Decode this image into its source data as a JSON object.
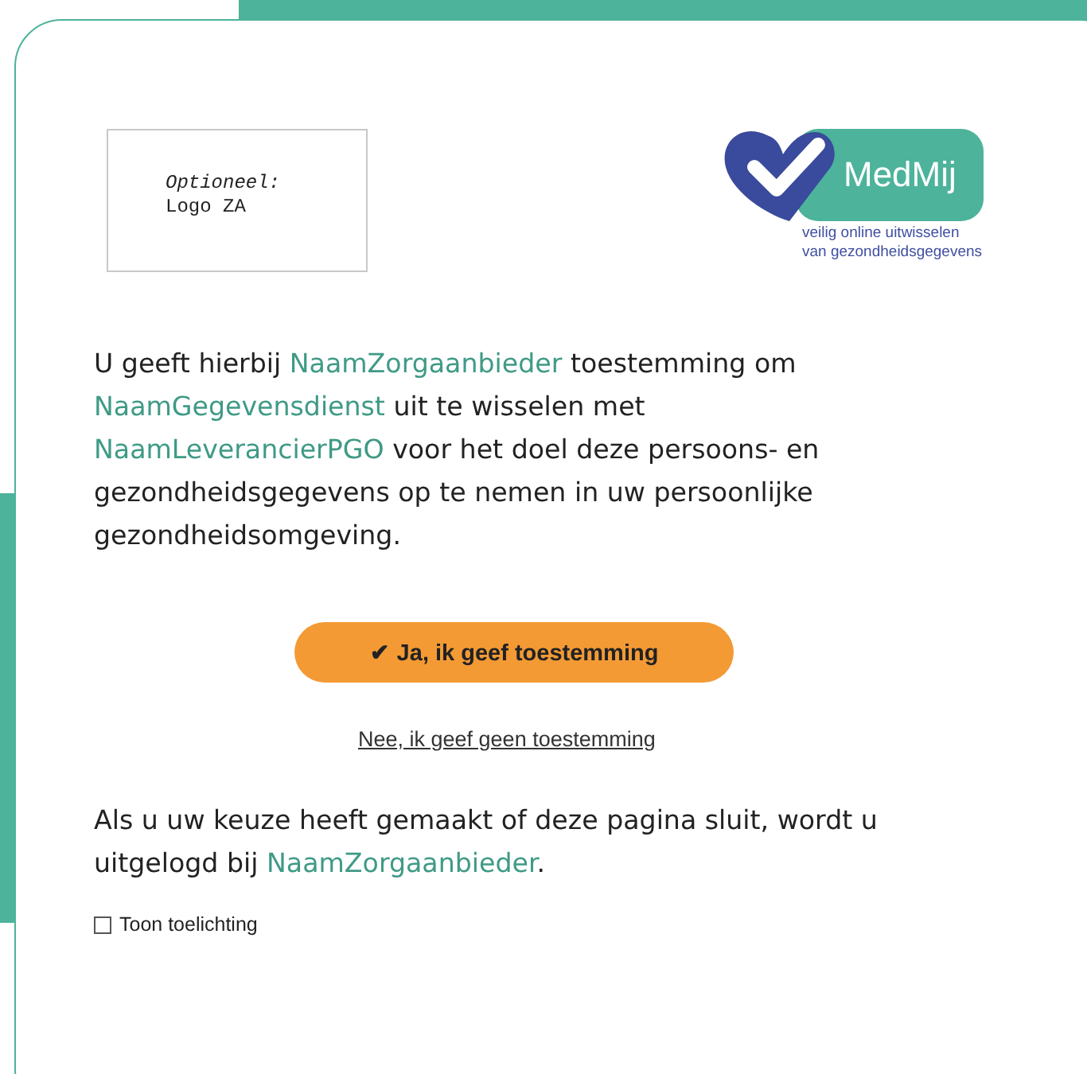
{
  "placeholder_logo": {
    "lines": [
      "Optioneel:",
      "Logo ZA"
    ]
  },
  "brand_logo": {
    "name": "MedMij",
    "tagline": [
      "veilig online uitwisselen",
      "van gezondheidsgegevens"
    ]
  },
  "consent_text": [
    {
      "text": "U geeft hierbij ",
      "highlight": false
    },
    {
      "text": "NaamZorgaanbieder",
      "highlight": true
    },
    {
      "text": " toestemming om ",
      "highlight": false
    },
    {
      "text": "NaamGegevensdienst",
      "highlight": true
    },
    {
      "text": " uit te wisselen met ",
      "highlight": false
    },
    {
      "text": "NaamLeverancierPGO",
      "highlight": true
    },
    {
      "text": " voor het doel deze persoons- en gezondheidsgegevens op te nemen in uw persoonlijke gezondheidsomgeving.",
      "highlight": false
    }
  ],
  "accept_button": {
    "icon": "✔",
    "label": "Ja, ik geef toestemming"
  },
  "decline_link": "Nee, ik geef geen toestemming",
  "logout_text": [
    {
      "text": "Als u uw keuze heeft gemaakt of deze pagina sluit, wordt u uitgelogd bij ",
      "highlight": false
    },
    {
      "text": "NaamZorgaanbieder",
      "highlight": true
    },
    {
      "text": ".",
      "highlight": false
    }
  ],
  "explain_checkbox": {
    "label": "Toon toelichting",
    "checked": false
  }
}
